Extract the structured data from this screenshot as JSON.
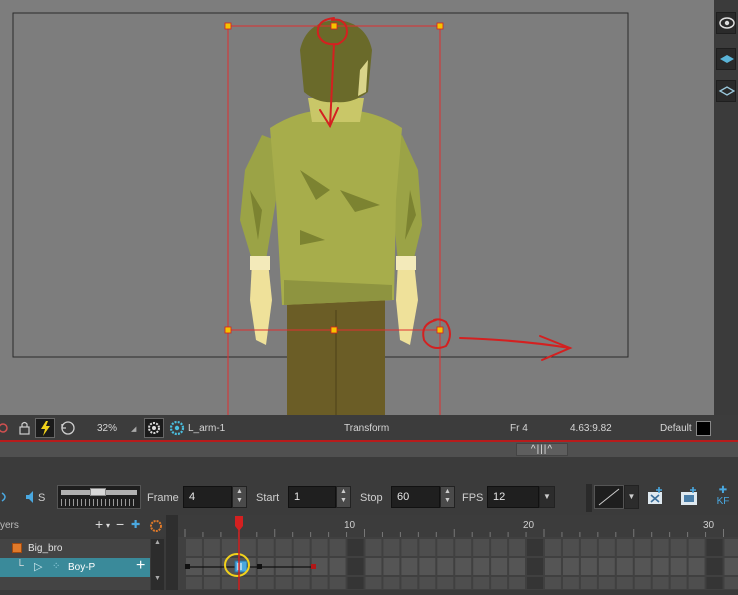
{
  "status_bar": {
    "zoom": "32%",
    "layer_name": "L_arm-1",
    "tool": "Transform",
    "frame": "Fr 4",
    "coordinates": "4.63:9.82",
    "palette": "Default"
  },
  "playback": {
    "frame_label": "Frame",
    "frame_value": "4",
    "start_label": "Start",
    "start_value": "1",
    "stop_label": "Stop",
    "stop_value": "60",
    "fps_label": "FPS",
    "fps_value": "12",
    "sound_label": "S",
    "kf_label": "KF"
  },
  "layers": {
    "header": "yers",
    "items": [
      {
        "name": "Big_bro"
      },
      {
        "name": "Boy-P"
      }
    ]
  },
  "timeline": {
    "ruler_labels": [
      "10",
      "20",
      "30"
    ],
    "current_frame": 4
  },
  "colors": {
    "annotation_red": "#d42020",
    "annotation_yellow": "#f2d21b",
    "selection_teal": "#3a8a9a",
    "accent_red": "#b71c1c"
  }
}
